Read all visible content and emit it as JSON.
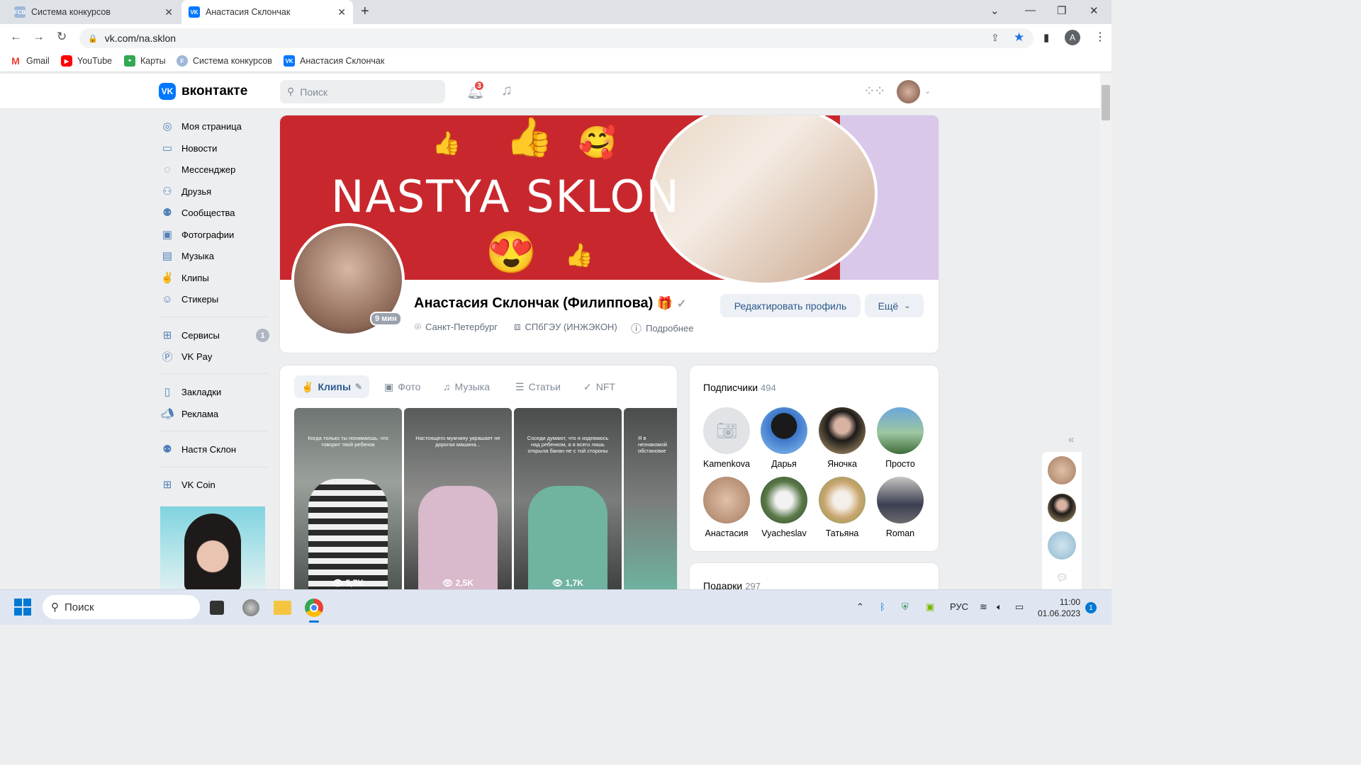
{
  "browser": {
    "tabs": [
      {
        "title": "Система конкурсов",
        "favicon": "FCB"
      },
      {
        "title": "Анастасия Склончак",
        "favicon": "VK"
      }
    ],
    "url": "vk.com/na.sklon",
    "bookmarks": [
      {
        "label": "Gmail",
        "icon": "gmail-icon"
      },
      {
        "label": "YouTube",
        "icon": "youtube-icon"
      },
      {
        "label": "Карты",
        "icon": "maps-icon"
      },
      {
        "label": "Система конкурсов",
        "icon": "fcb-icon"
      },
      {
        "label": "Анастасия Склончак",
        "icon": "vk-icon"
      }
    ],
    "profile_initial": "A"
  },
  "header": {
    "logo": "вконтакте",
    "search_placeholder": "Поиск",
    "notifications_count": "3"
  },
  "sidebar": {
    "items": [
      {
        "label": "Моя страница",
        "icon": "user-circle-icon"
      },
      {
        "label": "Новости",
        "icon": "news-icon"
      },
      {
        "label": "Мессенджер",
        "icon": "message-icon"
      },
      {
        "label": "Друзья",
        "icon": "friends-icon"
      },
      {
        "label": "Сообщества",
        "icon": "groups-icon"
      },
      {
        "label": "Фотографии",
        "icon": "photo-icon"
      },
      {
        "label": "Музыка",
        "icon": "music-icon"
      },
      {
        "label": "Клипы",
        "icon": "clips-icon"
      },
      {
        "label": "Стикеры",
        "icon": "smile-icon"
      }
    ],
    "items2": [
      {
        "label": "Сервисы",
        "icon": "services-icon",
        "badge": "1"
      },
      {
        "label": "VK Pay",
        "icon": "vkpay-icon"
      }
    ],
    "items3": [
      {
        "label": "Закладки",
        "icon": "bookmark-icon"
      },
      {
        "label": "Реклама",
        "icon": "megaphone-icon"
      }
    ],
    "items4": [
      {
        "label": "Настя Склон",
        "icon": "groups-icon"
      }
    ],
    "items5": [
      {
        "label": "VK Coin",
        "icon": "services-icon"
      }
    ]
  },
  "profile": {
    "cover_title": "NASTYA SKLON",
    "name": "Анастасия Склончак (Филиппова)",
    "last_seen": "9 мин",
    "city": "Санкт-Петербург",
    "university": "СПбГЭУ (ИНЖЭКОН)",
    "more_info": "Подробнее",
    "edit_button": "Редактировать профиль",
    "more_button": "Ещё"
  },
  "media_tabs": [
    {
      "label": "Клипы",
      "icon": "clips-icon"
    },
    {
      "label": "Фото",
      "icon": "photo-icon"
    },
    {
      "label": "Музыка",
      "icon": "music-icon"
    },
    {
      "label": "Статьи",
      "icon": "articles-icon"
    },
    {
      "label": "NFT",
      "icon": "nft-icon"
    }
  ],
  "clips": [
    {
      "caption": "Когда только ты понимаешь, что говорит твой ребенок",
      "views": "5,7K"
    },
    {
      "caption": "Настоящего мужчину украшает не дорогая машина...",
      "views": "2,5K"
    },
    {
      "caption": "Соседи думают, что я издеваюсь над ребенком, а я всего лишь открыла банан не с той стороны",
      "views": "1,7K"
    },
    {
      "caption": "Я в незнакомой обстановке",
      "views": ""
    }
  ],
  "subscribers": {
    "title": "Подписчики",
    "count": "494",
    "people": [
      {
        "name": "Kamenkova"
      },
      {
        "name": "Дарья"
      },
      {
        "name": "Яночка"
      },
      {
        "name": "Просто"
      },
      {
        "name": "Анастасия"
      },
      {
        "name": "Vyacheslav"
      },
      {
        "name": "Татьяна"
      },
      {
        "name": "Roman"
      }
    ]
  },
  "gifts": {
    "title": "Подарки",
    "count": "297"
  },
  "taskbar": {
    "search_placeholder": "Поиск",
    "language": "РУС",
    "time": "11:00",
    "date": "01.06.2023",
    "notifications": "1"
  }
}
